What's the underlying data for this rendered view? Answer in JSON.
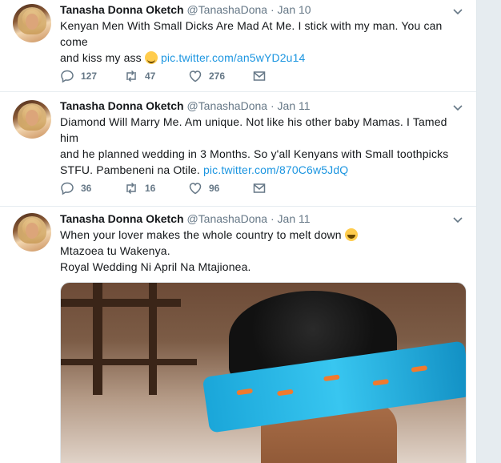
{
  "tweets": [
    {
      "name": "Tanasha Donna Oketch",
      "handle": "@TanashaDona",
      "sep": "·",
      "date": "Jan 10",
      "line1": "Kenyan Men With Small Dicks Are Mad At Me. I stick with my man. You can come",
      "line2_text": "and kiss my ass ",
      "link": "pic.twitter.com/an5wYD2u14",
      "emoji": "smiling-face-with-smiling-eyes",
      "replies": "127",
      "retweets": "47",
      "likes": "276"
    },
    {
      "name": "Tanasha Donna Oketch",
      "handle": "@TanashaDona",
      "sep": "·",
      "date": "Jan 11",
      "line1": "Diamond Will Marry Me. Am unique. Not like his other baby Mamas. I Tamed him",
      "line2": "and he planned wedding in 3 Months. So y'all Kenyans with Small toothpicks",
      "line3_text": "STFU. Pambeneni na Otile. ",
      "link": "pic.twitter.com/870C6w5JdQ",
      "replies": "36",
      "retweets": "16",
      "likes": "96"
    },
    {
      "name": "Tanasha Donna Oketch",
      "handle": "@TanashaDona",
      "sep": "·",
      "date": "Jan 11",
      "line1_text": "When your lover makes the whole country to melt down ",
      "emoji": "face-with-tears-of-joy",
      "line2": "Mtazoea tu Wakenya.",
      "line3": "Royal Wedding Ni April Na Mtajionea."
    }
  ],
  "colors": {
    "link": "#1b95e0",
    "text": "#14171a",
    "muted": "#657786"
  }
}
